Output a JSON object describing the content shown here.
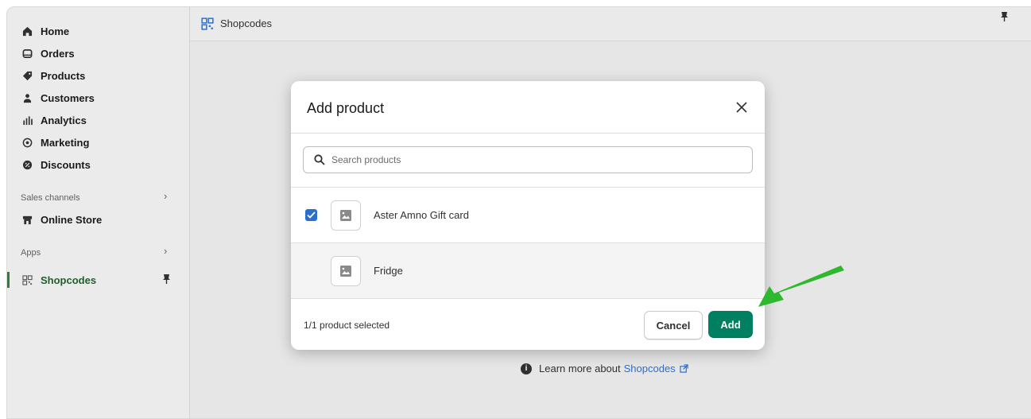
{
  "sidebar": {
    "items": [
      {
        "label": "Home",
        "icon": "home-icon"
      },
      {
        "label": "Orders",
        "icon": "orders-icon"
      },
      {
        "label": "Products",
        "icon": "tag-icon"
      },
      {
        "label": "Customers",
        "icon": "person-icon"
      },
      {
        "label": "Analytics",
        "icon": "bar-chart-icon"
      },
      {
        "label": "Marketing",
        "icon": "target-icon"
      },
      {
        "label": "Discounts",
        "icon": "discount-icon"
      }
    ],
    "sales_channels_label": "Sales channels",
    "online_store_label": "Online Store",
    "apps_label": "Apps",
    "shopcodes_label": "Shopcodes"
  },
  "topbar": {
    "title": "Shopcodes"
  },
  "learn_more": {
    "text": "Learn more about",
    "link": "Shopcodes"
  },
  "modal": {
    "title": "Add product",
    "search_placeholder": "Search products",
    "products": [
      {
        "name": "Aster Amno Gift card",
        "checked": true
      },
      {
        "name": "Fridge",
        "checked": false
      }
    ],
    "selected_count": "1/1 product selected",
    "cancel_label": "Cancel",
    "add_label": "Add"
  },
  "colors": {
    "accent": "#008060",
    "checkbox": "#2c6ecb",
    "arrow": "#2eb82e",
    "link": "#2c6ecb"
  }
}
